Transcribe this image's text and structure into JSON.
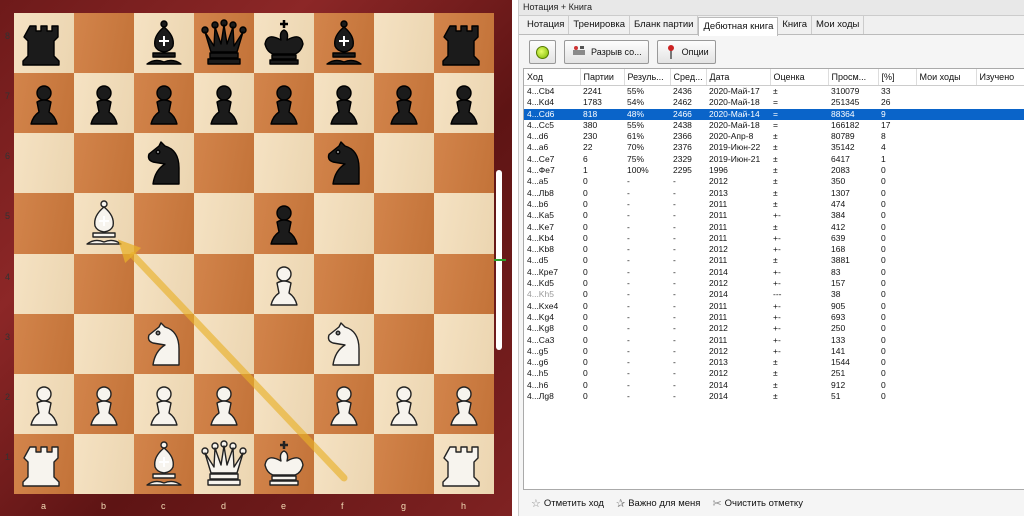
{
  "window_title": "Нотация + Книга",
  "tabs": [
    {
      "label": "Нотация"
    },
    {
      "label": "Тренировка"
    },
    {
      "label": "Бланк партии"
    },
    {
      "label": "Дебютная книга",
      "active": true
    },
    {
      "label": "Книга"
    },
    {
      "label": "Мои ходы"
    }
  ],
  "toolbar": {
    "disconnect_label": "Разрыв со...",
    "options_label": "Опции"
  },
  "table": {
    "columns": [
      "Ход",
      "Партии",
      "Резуль...",
      "Сред...",
      "Дата",
      "Оценка",
      "Просм...",
      "[%]",
      "Мои ходы",
      "Изучено"
    ],
    "rows": [
      [
        "4...Cb4",
        "2241",
        "55%",
        "2436",
        "2020-Май-17",
        "±",
        "310079",
        "33",
        "",
        ""
      ],
      [
        "4...Kd4",
        "1783",
        "54%",
        "2462",
        "2020-Май-18",
        "=",
        "251345",
        "26",
        "",
        ""
      ],
      [
        "4...Cd6",
        "818",
        "48%",
        "2466",
        "2020-Май-14",
        "=",
        "88364",
        "9",
        "",
        ""
      ],
      [
        "4...Cc5",
        "380",
        "55%",
        "2438",
        "2020-Май-18",
        "=",
        "166182",
        "17",
        "",
        ""
      ],
      [
        "4...d6",
        "230",
        "61%",
        "2366",
        "2020-Апр-8",
        "±",
        "80789",
        "8",
        "",
        ""
      ],
      [
        "4...a6",
        "22",
        "70%",
        "2376",
        "2019-Июн-22",
        "±",
        "35142",
        "4",
        "",
        ""
      ],
      [
        "4...Ce7",
        "6",
        "75%",
        "2329",
        "2019-Июн-21",
        "±",
        "6417",
        "1",
        "",
        ""
      ],
      [
        "4...Фe7",
        "1",
        "100%",
        "2295",
        "1996",
        "±",
        "2083",
        "0",
        "",
        ""
      ],
      [
        "4...a5",
        "0",
        "-",
        "-",
        "2012",
        "±",
        "350",
        "0",
        "",
        ""
      ],
      [
        "4...Лb8",
        "0",
        "-",
        "-",
        "2013",
        "±",
        "1307",
        "0",
        "",
        ""
      ],
      [
        "4...b6",
        "0",
        "-",
        "-",
        "2011",
        "±",
        "474",
        "0",
        "",
        ""
      ],
      [
        "4...Ka5",
        "0",
        "-",
        "-",
        "2011",
        "+-",
        "384",
        "0",
        "",
        ""
      ],
      [
        "4...Ke7",
        "0",
        "-",
        "-",
        "2011",
        "±",
        "412",
        "0",
        "",
        ""
      ],
      [
        "4...Kb4",
        "0",
        "-",
        "-",
        "2011",
        "+-",
        "639",
        "0",
        "",
        ""
      ],
      [
        "4...Kb8",
        "0",
        "-",
        "-",
        "2012",
        "+-",
        "168",
        "0",
        "",
        ""
      ],
      [
        "4...d5",
        "0",
        "-",
        "-",
        "2011",
        "±",
        "3881",
        "0",
        "",
        ""
      ],
      [
        "4...Кре7",
        "0",
        "-",
        "-",
        "2014",
        "+-",
        "83",
        "0",
        "",
        ""
      ],
      [
        "4...Kd5",
        "0",
        "-",
        "-",
        "2012",
        "+-",
        "157",
        "0",
        "",
        ""
      ],
      [
        "4...Kh5",
        "0",
        "-",
        "-",
        "2014",
        "---",
        "38",
        "0",
        "",
        ""
      ],
      [
        "4...Kxe4",
        "0",
        "-",
        "-",
        "2011",
        "+-",
        "905",
        "0",
        "",
        ""
      ],
      [
        "4...Kg4",
        "0",
        "-",
        "-",
        "2011",
        "+-",
        "693",
        "0",
        "",
        ""
      ],
      [
        "4...Kg8",
        "0",
        "-",
        "-",
        "2012",
        "+-",
        "250",
        "0",
        "",
        ""
      ],
      [
        "4...Ca3",
        "0",
        "-",
        "-",
        "2011",
        "+-",
        "133",
        "0",
        "",
        ""
      ],
      [
        "4...g5",
        "0",
        "-",
        "-",
        "2012",
        "+-",
        "141",
        "0",
        "",
        ""
      ],
      [
        "4...g6",
        "0",
        "-",
        "-",
        "2013",
        "±",
        "1544",
        "0",
        "",
        ""
      ],
      [
        "4...h5",
        "0",
        "-",
        "-",
        "2012",
        "±",
        "251",
        "0",
        "",
        ""
      ],
      [
        "4...h6",
        "0",
        "-",
        "-",
        "2014",
        "±",
        "912",
        "0",
        "",
        ""
      ],
      [
        "4...Лg8",
        "0",
        "-",
        "-",
        "2014",
        "±",
        "51",
        "0",
        "",
        ""
      ]
    ],
    "selected_row": 2,
    "grey_row": 18
  },
  "bottom_bar": {
    "mark_move": "Отметить ход",
    "important": "Важно для меня",
    "clear_mark": "Очистить отметку"
  },
  "board": {
    "files": [
      "a",
      "b",
      "c",
      "d",
      "e",
      "f",
      "g",
      "h"
    ],
    "ranks": [
      "8",
      "7",
      "6",
      "5",
      "4",
      "3",
      "2",
      "1"
    ],
    "pieces": [
      {
        "sq": "a8",
        "p": "bR"
      },
      {
        "sq": "c8",
        "p": "bB"
      },
      {
        "sq": "d8",
        "p": "bQ"
      },
      {
        "sq": "e8",
        "p": "bK"
      },
      {
        "sq": "f8",
        "p": "bB"
      },
      {
        "sq": "h8",
        "p": "bR"
      },
      {
        "sq": "a7",
        "p": "bP"
      },
      {
        "sq": "b7",
        "p": "bP"
      },
      {
        "sq": "c7",
        "p": "bP"
      },
      {
        "sq": "d7",
        "p": "bP"
      },
      {
        "sq": "e7",
        "p": "bP"
      },
      {
        "sq": "f7",
        "p": "bP"
      },
      {
        "sq": "g7",
        "p": "bP"
      },
      {
        "sq": "h7",
        "p": "bP"
      },
      {
        "sq": "c6",
        "p": "bN"
      },
      {
        "sq": "f6",
        "p": "bN"
      },
      {
        "sq": "b5",
        "p": "wB"
      },
      {
        "sq": "e5",
        "p": "bP"
      },
      {
        "sq": "e4",
        "p": "wP"
      },
      {
        "sq": "c3",
        "p": "wN"
      },
      {
        "sq": "f3",
        "p": "wN"
      },
      {
        "sq": "a2",
        "p": "wP"
      },
      {
        "sq": "b2",
        "p": "wP"
      },
      {
        "sq": "c2",
        "p": "wP"
      },
      {
        "sq": "d2",
        "p": "wP"
      },
      {
        "sq": "f2",
        "p": "wP"
      },
      {
        "sq": "g2",
        "p": "wP"
      },
      {
        "sq": "h2",
        "p": "wP"
      },
      {
        "sq": "a1",
        "p": "wR"
      },
      {
        "sq": "c1",
        "p": "wB"
      },
      {
        "sq": "d1",
        "p": "wQ"
      },
      {
        "sq": "e1",
        "p": "wK"
      },
      {
        "sq": "h1",
        "p": "wR"
      }
    ],
    "arrow": {
      "from": "f1",
      "to": "b5",
      "color": "#e8b02a"
    },
    "light_color": "#f3dcb6",
    "dark_color": "#cf7a3c"
  }
}
